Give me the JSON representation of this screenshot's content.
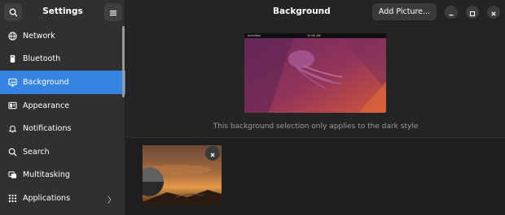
{
  "sidebar": {
    "title": "Settings",
    "icons": {
      "search": "search-icon",
      "menu": "hamburger-menu-icon"
    },
    "items": [
      {
        "label": "Network",
        "icon": "network-icon"
      },
      {
        "label": "Bluetooth",
        "icon": "bluetooth-icon"
      },
      {
        "label": "Background",
        "icon": "background-icon",
        "active": true
      },
      {
        "label": "Appearance",
        "icon": "appearance-icon"
      },
      {
        "label": "Notifications",
        "icon": "notifications-icon"
      },
      {
        "label": "Search",
        "icon": "search-icon"
      },
      {
        "label": "Multitasking",
        "icon": "multitasking-icon"
      },
      {
        "label": "Applications",
        "icon": "applications-icon",
        "chevron": "〉"
      }
    ]
  },
  "main": {
    "title": "Background",
    "add_button": "Add Picture...",
    "window_controls": [
      "minimize-icon",
      "maximize-icon",
      "close-icon"
    ],
    "preview": {
      "topbar_left": "Activities",
      "topbar_center": "10:00 AM"
    },
    "caption": "This background selection only applies to the dark style",
    "thumbnail_remove": "remove-icon"
  },
  "colors": {
    "accent": "#3584e4",
    "sidebar_bg": "#303030",
    "window_bg": "#242424",
    "gallery_bg": "#1e1e1e"
  }
}
